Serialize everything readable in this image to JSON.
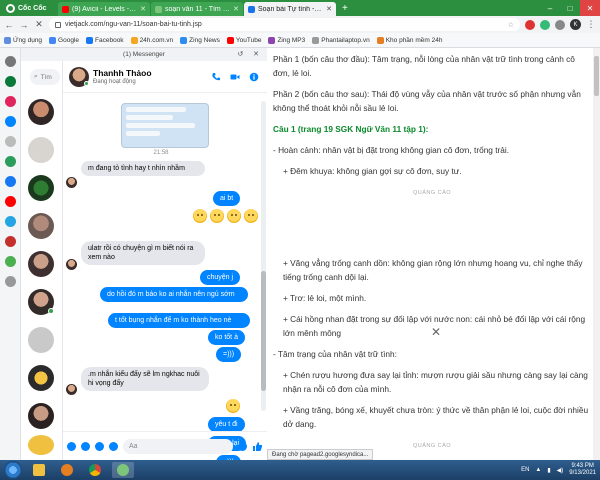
{
  "browser": {
    "brand": "Cốc Cốc",
    "tabs": [
      {
        "title": "(9) Avicii - Levels - YouT",
        "favicon_color": "#ff0000",
        "active": false
      },
      {
        "title": "soạn văn 11 - Tìm với Cốc Cốc",
        "favicon_color": "#2c8f3f",
        "active": false
      },
      {
        "title": "Soạn bài Tự tình - Hồ Xuân",
        "favicon_color": "#1a73e8",
        "active": true
      }
    ],
    "url": "vietjack.com/ngu-van-11/soan-bai-tu-tinh.jsp",
    "profile_initial": "K",
    "bookmarks": [
      "Ứng dụng",
      "Google",
      "Facebook",
      "24h.com.vn",
      "Zing News",
      "YouTube",
      "Zing MP3",
      "Phantailaptop.vn",
      "Kho phần mềm 24h"
    ],
    "status": "Đang chờ pagead2.googlesyndica..."
  },
  "messenger": {
    "window_title": "(1) Messenger",
    "search_placeholder": "Tìm",
    "contact": {
      "name": "Thanhh Thảoo",
      "status": "Đang hoạt động"
    },
    "timestamp": "21:58",
    "messages": [
      {
        "dir": "in",
        "text": "m đang tỏ tình hay t nhìn nhầm"
      },
      {
        "dir": "out",
        "text": "ai bt"
      },
      {
        "dir": "in",
        "text": "ulatr rồi có chuyện gì m biết nói ra xem nào"
      },
      {
        "dir": "out",
        "text": "chuyện j"
      },
      {
        "dir": "out",
        "text": "do hồi đó m báo ko ai nhắn nên ngủ sớm"
      },
      {
        "dir": "out",
        "text": "t tốt bụng nhắn để m ko thành heo nè"
      },
      {
        "dir": "out",
        "text": "ko tốt à"
      },
      {
        "dir": "out",
        "text": "=)))"
      },
      {
        "dir": "in",
        "text": ".m nhắn kiểu đấy sẽ lm ngkhac nuôi hi vọng đấy"
      },
      {
        "dir": "out",
        "text": "yêu t đi"
      },
      {
        "dir": "out",
        "text": "t yêu lại"
      },
      {
        "dir": "out",
        "text": "=)))"
      }
    ],
    "composer_placeholder": "Aa"
  },
  "article": {
    "paragraphs": [
      {
        "cls": "p",
        "text": "Phần 1 (bốn câu thơ đầu): Tâm trạng, nỗi lòng của nhân vật trữ tình trong cảnh cô đơn, lẻ loi."
      },
      {
        "cls": "p",
        "text": "Phần 2 (bốn câu thơ sau): Thái độ vùng vẫy của nhân vật trước số phận nhưng vẫn không thể thoát khỏi nỗi sầu lẻ loi."
      },
      {
        "cls": "h",
        "text": "Câu 1 (trang 19 SGK Ngữ Văn 11 tập 1):"
      },
      {
        "cls": "p",
        "text": "- Hoàn cảnh: nhân vật bị đặt trong không gian cô đơn, trống trải."
      },
      {
        "cls": "p",
        "text": "+ Đêm khuya: không gian gợi sự cô đơn, suy tư."
      }
    ],
    "ads_label": "QUẢNG CÁO",
    "paragraphs2": [
      {
        "text": "+ Văng vẳng trống canh dồn: không gian rộng lớn nhưng hoang vu, chỉ nghe thấy tiếng trống canh dội lại."
      },
      {
        "text": "+ Trơ: lẻ loi, một mình."
      },
      {
        "text": "+ Cái hồng nhan đặt trong sự đối lập với nước non: cái nhỏ bé đối lập với cái rộng lớn mênh mông"
      },
      {
        "text": "- Tâm trạng của nhân vật trữ tình:"
      },
      {
        "text": "+ Chén rượu hương đưa say lại tỉnh: mượn rượu giải sầu nhưng càng say lại càng nhận ra nỗi cô đơn của mình."
      },
      {
        "text": "+ Vầng trăng, bóng xế, khuyết chưa tròn: ý thức về thân phận lẻ loi, cuộc đời nhiều dở dang."
      }
    ],
    "ads_label2": "QUẢNG CÁO"
  },
  "taskbar": {
    "lang": "EN",
    "time": "9:43 PM",
    "date": "9/13/2021"
  }
}
